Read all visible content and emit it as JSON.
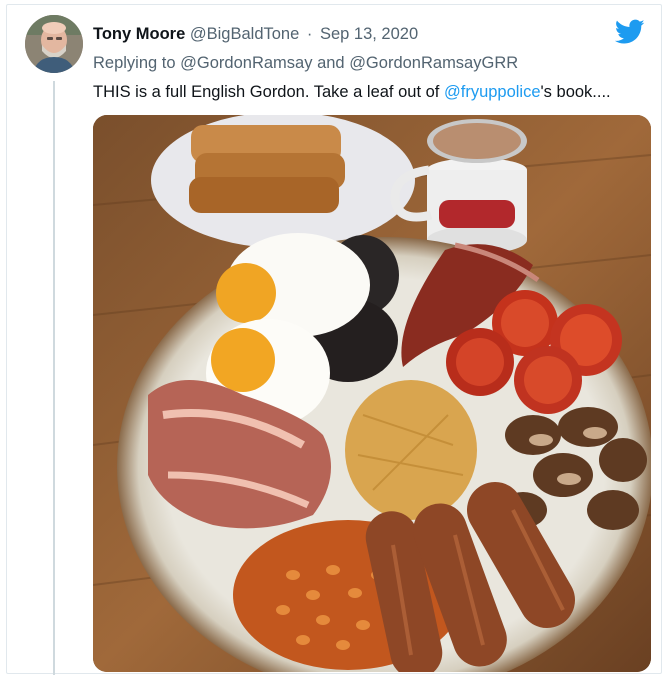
{
  "tweet": {
    "display_name": "Tony Moore",
    "handle": "@BigBaldTone",
    "separator": "·",
    "date": "Sep 13, 2020",
    "reply_prefix": "Replying to",
    "reply_to": [
      "@GordonRamsay",
      "@GordonRamsayGRR"
    ],
    "reply_joiner": "and",
    "text_before": "THIS is a full English Gordon. Take a leaf out of",
    "text_mention": "@fryuppolice",
    "text_after": "'s book....",
    "media_icon": "photo-full-english-breakfast",
    "avatar_icon": "user-avatar-icon",
    "brand_icon": "twitter-bird-icon"
  },
  "colors": {
    "link": "#1d9bf0",
    "secondary": "#536471",
    "brand": "#1d9bf0",
    "thread_line": "#cfd9de"
  }
}
